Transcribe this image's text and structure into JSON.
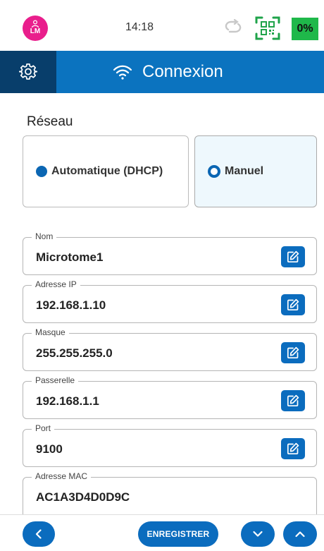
{
  "status_bar": {
    "avatar_initials": "LM",
    "time": "14:18",
    "battery": "0%",
    "icons": [
      "user-icon",
      "sync-icon",
      "qr-code-icon"
    ]
  },
  "header": {
    "title": "Connexion",
    "icons": [
      "settings-gear-icon",
      "wifi-icon"
    ]
  },
  "network": {
    "section_label": "Réseau",
    "modes": [
      {
        "label": "Automatique (DHCP)",
        "selected": false
      },
      {
        "label": "Manuel",
        "selected": true
      }
    ]
  },
  "fields": [
    {
      "label": "Nom",
      "value": "Microtome1",
      "editable": true
    },
    {
      "label": "Adresse IP",
      "value": "192.168.1.10",
      "editable": true
    },
    {
      "label": "Masque",
      "value": "255.255.255.0",
      "editable": true
    },
    {
      "label": "Passerelle",
      "value": "192.168.1.1",
      "editable": true
    },
    {
      "label": "Port",
      "value": "9100",
      "editable": true
    },
    {
      "label": "Adresse MAC",
      "value": "AC1A3D4D0D9C",
      "editable": false
    }
  ],
  "bottom_bar": {
    "save_label": "ENREGISTRER",
    "icons": [
      "back-chevron-icon",
      "chevron-down-icon",
      "chevron-up-icon"
    ]
  },
  "colors": {
    "primary": "#0b6cbe",
    "header": "#0b73bf",
    "header_dark": "#083e6b",
    "avatar": "#e91e8c",
    "battery": "#1fb84a",
    "qr": "#1fa34a",
    "selected_card": "#eef8fd"
  }
}
